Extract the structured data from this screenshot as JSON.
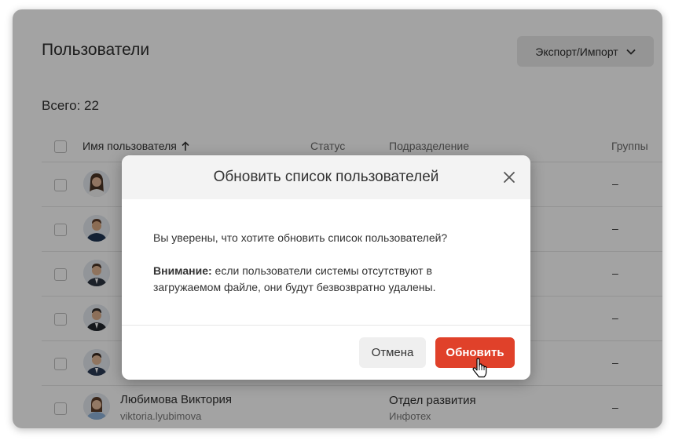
{
  "page": {
    "title": "Пользователи",
    "export_label": "Экспорт/Импорт",
    "total_label": "Всего: 22"
  },
  "table": {
    "headers": {
      "name": "Имя пользователя",
      "status": "Статус",
      "department": "Подразделение",
      "groups": "Группы"
    },
    "rows": [
      {
        "groups": "–"
      },
      {
        "groups": "–"
      },
      {
        "groups": "–"
      },
      {
        "groups": "–"
      },
      {
        "groups": "–"
      },
      {
        "name": "Любимова Виктория",
        "login": "viktoria.lyubimova",
        "department": "Отдел развития",
        "org": "Инфотех",
        "groups": "–"
      }
    ]
  },
  "modal": {
    "title": "Обновить список пользователей",
    "question": "Вы уверены, что хотите обновить список пользователей?",
    "warning_label": "Внимание:",
    "warning_text": " если пользователи системы отсутствуют в загружаемом файле, они будут безвозвратно удалены.",
    "cancel_label": "Отмена",
    "confirm_label": "Обновить"
  },
  "colors": {
    "accent": "#e0412a",
    "overlay": "rgba(0,0,0,0.36)"
  },
  "icons": {
    "export_dropdown": "chevron-down-icon",
    "sort": "arrow-up-icon",
    "close": "close-icon",
    "cursor": "hand-pointer-icon"
  }
}
